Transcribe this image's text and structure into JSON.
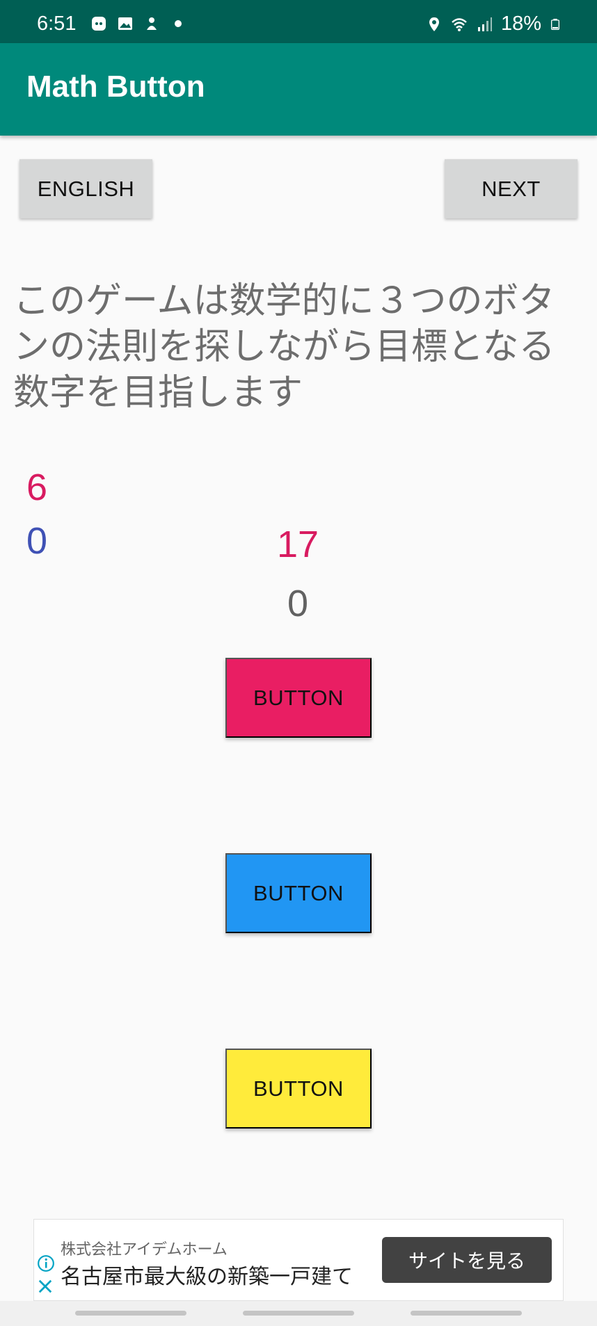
{
  "status_bar": {
    "time": "6:51",
    "battery": "18%",
    "left_icons": [
      "game-icon",
      "image-icon",
      "notification-icon",
      "dot-icon"
    ],
    "right_icons": [
      "location-icon",
      "wifi-icon",
      "signal-icon",
      "battery-icon"
    ]
  },
  "app_bar": {
    "title": "Math Button",
    "color": "#00897b"
  },
  "buttons": {
    "english": "ENGLISH",
    "next": "NEXT"
  },
  "description": "このゲームは数学的に３つのボタンの法則を探しながら目標となる数字を目指します",
  "numbers": {
    "left_top": "6",
    "left_bottom": "0",
    "center_target": "17",
    "center_value": "0"
  },
  "color_buttons": [
    {
      "label": "BUTTON",
      "color": "#e91e63"
    },
    {
      "label": "BUTTON",
      "color": "#2196f3"
    },
    {
      "label": "BUTTON",
      "color": "#ffeb3b"
    }
  ],
  "ad": {
    "company": "株式会社アイデムホーム",
    "headline": "名古屋市最大級の新築一戸建て",
    "cta": "サイトを見る"
  }
}
